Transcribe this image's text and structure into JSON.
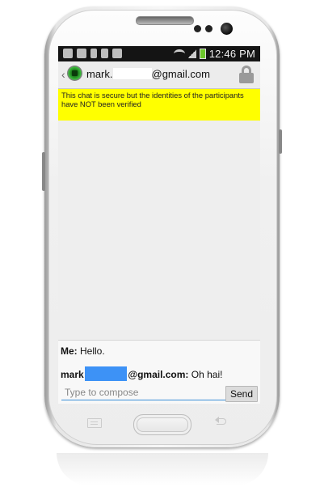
{
  "status_bar": {
    "time": "12:46 PM",
    "icons": [
      "image-icon",
      "voicemail-icon",
      "wrench-icon",
      "lock-icon",
      "play-icon",
      "wifi-icon",
      "signal-icon",
      "battery-charging-icon"
    ]
  },
  "header": {
    "contact_prefix": "mark.",
    "contact_suffix": "@gmail.com",
    "lock_icon": "lock-icon"
  },
  "notice": {
    "text": "This chat is secure but the identities of the participants have NOT been verified",
    "color": "#ffff00"
  },
  "messages": [
    {
      "sender": "Me:",
      "text": " Hello."
    },
    {
      "sender_prefix": "mark",
      "sender_suffix": "@gmail.com:",
      "text": " Oh hai!"
    }
  ],
  "compose": {
    "placeholder": "Type to compose",
    "send_label": "Send"
  },
  "colors": {
    "accent": "#3c8fd8",
    "redaction": "#3d92f6",
    "battery": "#6cc72a"
  }
}
